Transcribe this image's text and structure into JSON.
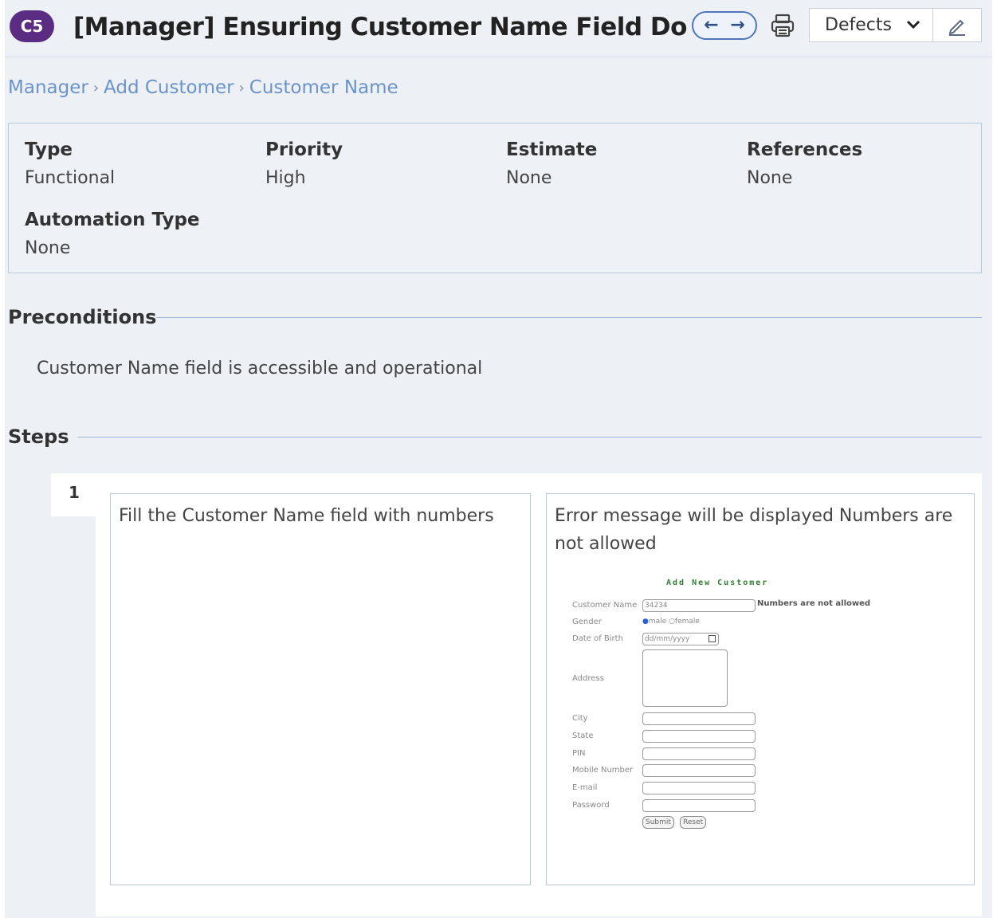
{
  "header": {
    "case_id": "C5",
    "title": "[Manager] Ensuring Customer Name Field Does ...",
    "prev_arrow": "←",
    "next_arrow": "→",
    "defects_label": "Defects"
  },
  "breadcrumb": [
    "Manager",
    "Add Customer",
    "Customer Name"
  ],
  "breadcrumb_separator": "›",
  "properties": {
    "type": {
      "label": "Type",
      "value": "Functional"
    },
    "priority": {
      "label": "Priority",
      "value": "High"
    },
    "estimate": {
      "label": "Estimate",
      "value": "None"
    },
    "references": {
      "label": "References",
      "value": "None"
    },
    "automation_type": {
      "label": "Automation Type",
      "value": "None"
    }
  },
  "preconditions": {
    "title": "Preconditions",
    "text": "Customer Name field is accessible and operational"
  },
  "steps": {
    "title": "Steps",
    "items": [
      {
        "number": "1",
        "action": "Fill the Customer Name field with numbers",
        "expected": "Error message will be displayed Numbers are not allowed"
      }
    ]
  },
  "attachment_form": {
    "title": "Add New Customer",
    "customer_name_label": "Customer Name",
    "customer_name_value": "34234",
    "error_text": "Numbers are not allowed",
    "gender_label": "Gender",
    "gender_male": "male",
    "gender_female": "female",
    "dob_label": "Date of Birth",
    "dob_placeholder": "dd/mm/yyyy",
    "address_label": "Address",
    "city_label": "City",
    "state_label": "State",
    "pin_label": "PIN",
    "mobile_label": "Mobile Number",
    "email_label": "E-mail",
    "password_label": "Password",
    "submit_label": "Submit",
    "reset_label": "Reset"
  },
  "colors": {
    "badge": "#5b2d82",
    "link": "#6a93c9",
    "nav_border": "#4f76b8",
    "background": "#edf1f6"
  }
}
